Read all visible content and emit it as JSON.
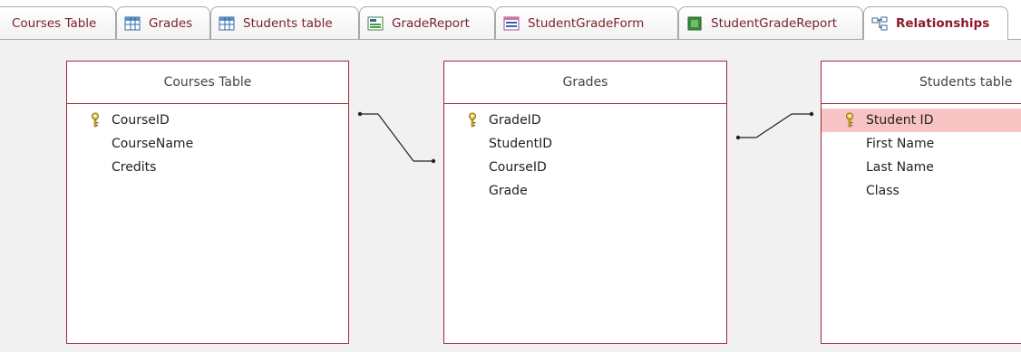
{
  "tabs": [
    {
      "label": "Courses Table",
      "icon": "none"
    },
    {
      "label": "Grades",
      "icon": "table-icon"
    },
    {
      "label": "Students table",
      "icon": "table-icon"
    },
    {
      "label": "GradeReport",
      "icon": "report-icon"
    },
    {
      "label": "StudentGradeForm",
      "icon": "form-icon"
    },
    {
      "label": "StudentGradeReport",
      "icon": "macro-icon"
    },
    {
      "label": "Relationships",
      "icon": "relationships-icon",
      "active": true
    }
  ],
  "tables": {
    "courses": {
      "title": "Courses Table",
      "fields": [
        "CourseID",
        "CourseName",
        "Credits"
      ],
      "key_field": "CourseID"
    },
    "grades": {
      "title": "Grades",
      "fields": [
        "GradeID",
        "StudentID",
        "CourseID",
        "Grade"
      ],
      "key_field": "GradeID"
    },
    "students": {
      "title": "Students table",
      "fields": [
        "Student ID",
        "First Name",
        "Last Name",
        "Class"
      ],
      "key_field": "Student ID",
      "selected_field": "Student ID"
    }
  },
  "colors": {
    "accent": "#9b2b3b",
    "selection": "#f7c3c3",
    "canvas": "#f1f1f1"
  }
}
